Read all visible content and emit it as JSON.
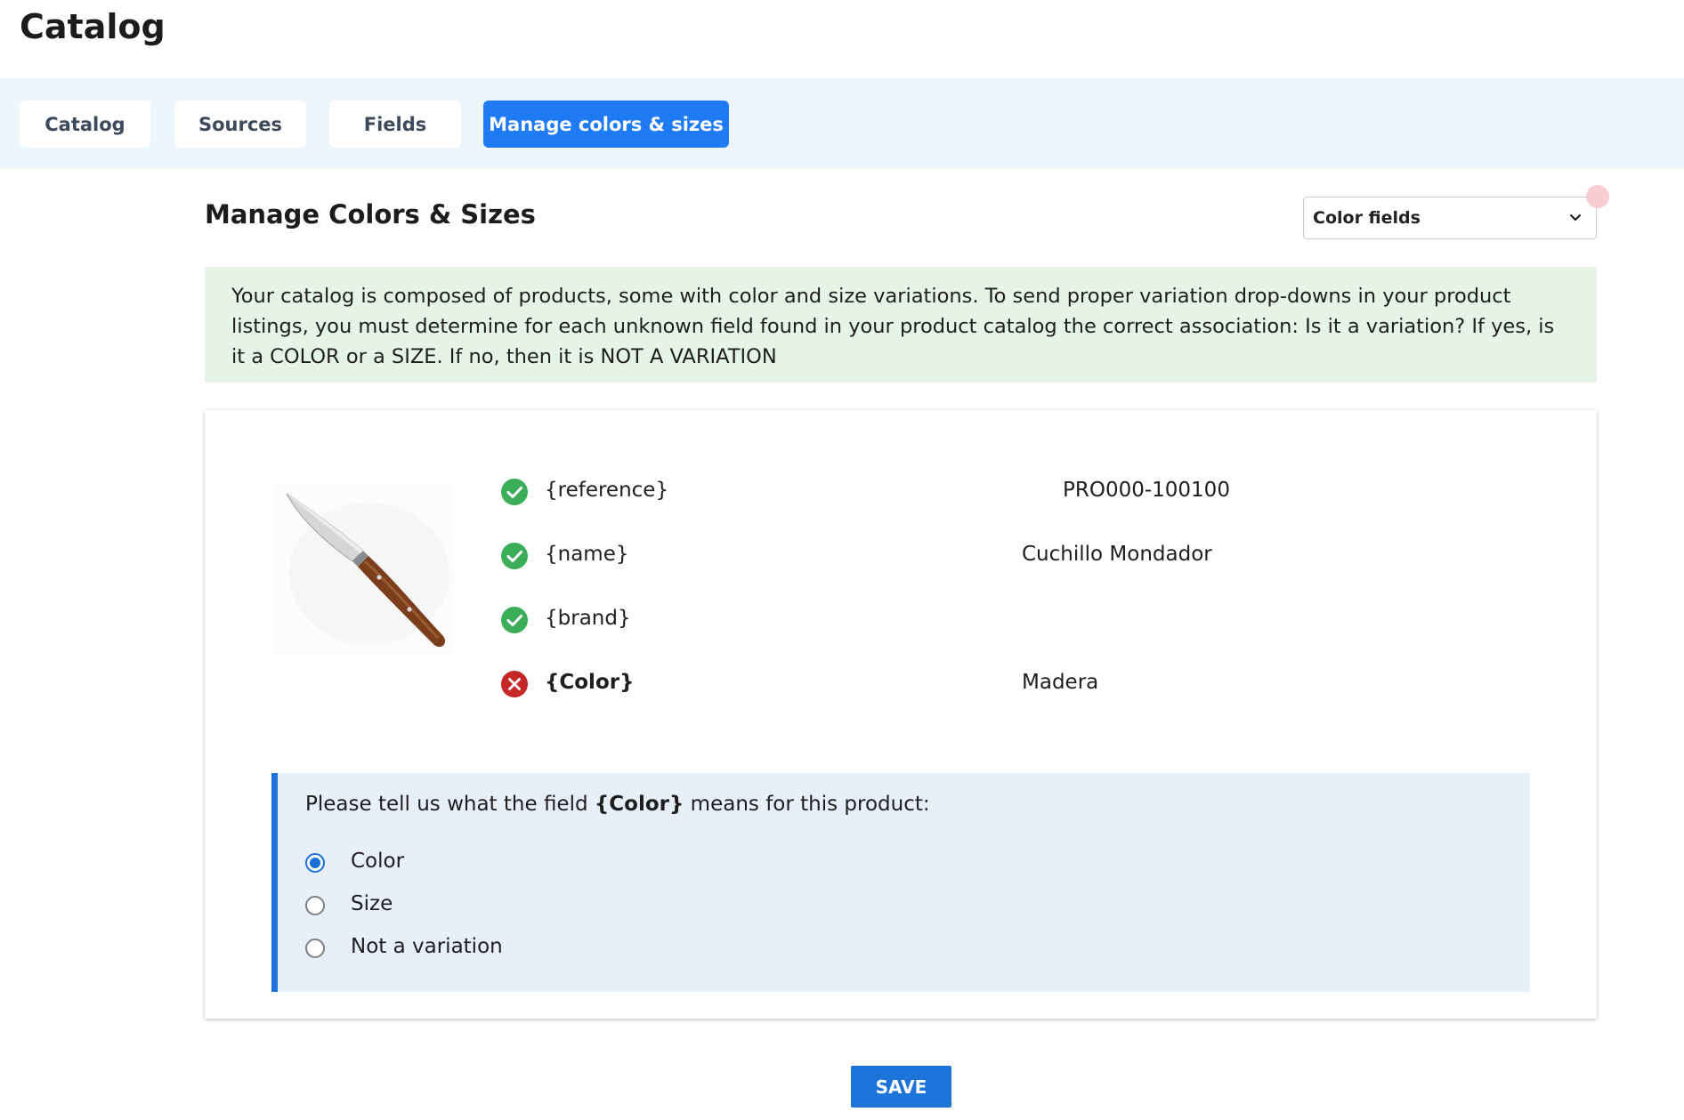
{
  "page": {
    "title": "Catalog"
  },
  "tabs": [
    {
      "label": "Catalog",
      "active": false
    },
    {
      "label": "Sources",
      "active": false
    },
    {
      "label": "Fields",
      "active": false
    },
    {
      "label": "Manage colors & sizes",
      "active": true
    }
  ],
  "section": {
    "title": "Manage Colors & Sizes",
    "filter_select": {
      "value": "Color fields"
    }
  },
  "info": {
    "text": "Your catalog is composed of products, some with color and size variations. To send proper variation drop-downs in your product listings, you must determine for each unknown field found in your product catalog the correct association: Is it a variation? If yes, is it a COLOR or a SIZE. If no, then it is NOT A VARIATION"
  },
  "product": {
    "image_icon": "kitchen-knife",
    "fields": [
      {
        "key": "{reference}",
        "value": "PRO000-100100",
        "status": "ok",
        "icon": "check-circle-icon"
      },
      {
        "key": "{name}",
        "value": "Cuchillo Mondador",
        "status": "ok",
        "icon": "check-circle-icon"
      },
      {
        "key": "{brand}",
        "value": "",
        "status": "ok",
        "icon": "check-circle-icon"
      },
      {
        "key": "{Color}",
        "value": "Madera",
        "status": "error",
        "icon": "error-circle-icon"
      }
    ]
  },
  "question": {
    "prefix": "Please tell us what the field ",
    "field": "{Color}",
    "suffix": " means for this product:",
    "options": [
      {
        "label": "Color",
        "selected": true
      },
      {
        "label": "Size",
        "selected": false
      },
      {
        "label": "Not a variation",
        "selected": false
      }
    ]
  },
  "actions": {
    "save_label": "SAVE"
  },
  "colors": {
    "accent": "#1f7af5",
    "tab_bar_bg": "#eef6fd",
    "info_bg": "#e5f4e6",
    "question_bg": "#e7eff9",
    "ok": "#3cae59",
    "error": "#c62828"
  }
}
